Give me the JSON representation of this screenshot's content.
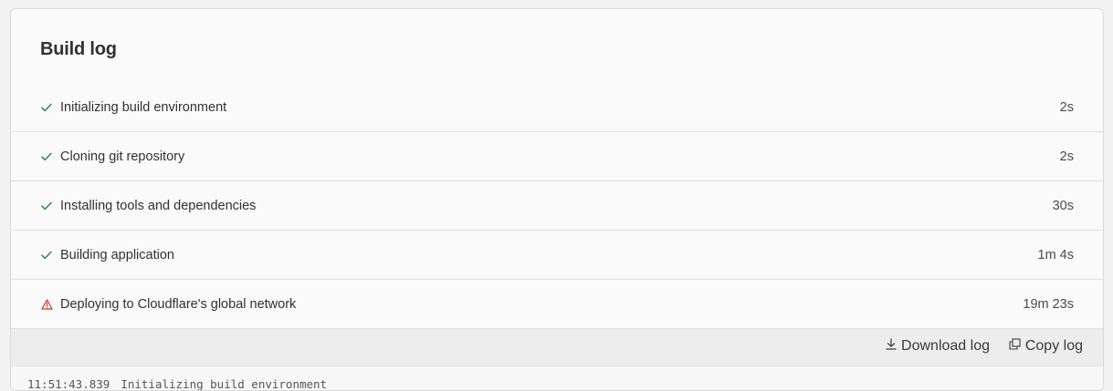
{
  "build_log": {
    "title": "Build log",
    "steps": [
      {
        "label": "Initializing build environment",
        "duration": "2s",
        "status": "success"
      },
      {
        "label": "Cloning git repository",
        "duration": "2s",
        "status": "success"
      },
      {
        "label": "Installing tools and dependencies",
        "duration": "30s",
        "status": "success"
      },
      {
        "label": "Building application",
        "duration": "1m 4s",
        "status": "success"
      },
      {
        "label": "Deploying to Cloudflare's global network",
        "duration": "19m 23s",
        "status": "warning"
      }
    ],
    "toolbar": {
      "download_label": "Download log",
      "copy_label": "Copy log"
    },
    "log_lines": [
      {
        "time": "11:51:43.839",
        "text": "Initializing build environment"
      }
    ]
  },
  "icons": {
    "success": "check-icon",
    "warning": "warning-triangle-icon",
    "download": "download-icon",
    "copy": "copy-icon"
  },
  "colors": {
    "success": "#2e8a3e",
    "warning": "#c0392b"
  }
}
